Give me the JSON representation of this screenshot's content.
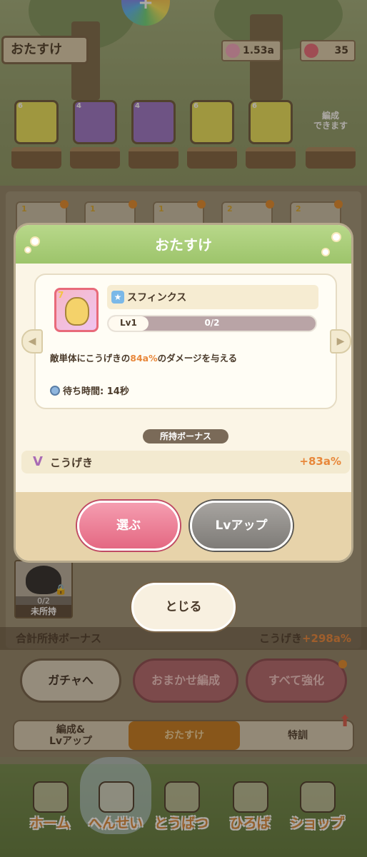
{
  "header": {
    "title": "おたすけ",
    "candy_value": "1.53a",
    "lollipop_value": "35"
  },
  "team": {
    "slots": [
      {
        "stars": "6",
        "color": "#e8e35a"
      },
      {
        "stars": "4",
        "color": "#9a74c8"
      },
      {
        "stars": "4",
        "color": "#9a74c8"
      },
      {
        "stars": "6",
        "color": "#e8e35a"
      },
      {
        "stars": "6",
        "color": "#e8e35a"
      }
    ],
    "can_form_label": "編成\nできます"
  },
  "collection": {
    "stars": [
      "1",
      "1",
      "1",
      "2",
      "2"
    ],
    "locked_card": {
      "count": "0/2",
      "status": "未所持"
    }
  },
  "modal": {
    "title": "おたすけ",
    "character": {
      "name": "スフィンクス",
      "stars": "7",
      "level_label": "Lv1",
      "level_progress": "0/2",
      "level_progress_fraction": 0
    },
    "description_prefix": "敵単体にこうげきの",
    "description_highlight": "84a%",
    "description_suffix": "のダメージを与える",
    "wait_time": "待ち時間: 14秒",
    "bonus_section_label": "所持ボーナス",
    "attack_label": "こうげき",
    "attack_value": "+83a%",
    "select_label": "選ぶ",
    "levelup_label": "Lvアップ"
  },
  "close_label": "とじる",
  "total_bonus": {
    "label": "合計所持ボーナス",
    "stat_label": "こうげき",
    "stat_value": "+298a%"
  },
  "actions": {
    "gacha_label": "ガチャへ",
    "auto_label": "おまかせ編成",
    "strengthen_all_label": "すべて強化"
  },
  "tabs": {
    "edit_line1": "編成&",
    "edit_line2": "Lvアップ",
    "help": "おたすけ",
    "training": "特訓"
  },
  "nav": {
    "home": "ホーム",
    "formation": "へんせい",
    "subjugation": "とうばつ",
    "plaza": "ひろば",
    "shop": "ショップ"
  },
  "colors": {
    "accent_orange": "#e8873a",
    "select_pink": "#e46882",
    "header_green": "#9dc46b"
  }
}
